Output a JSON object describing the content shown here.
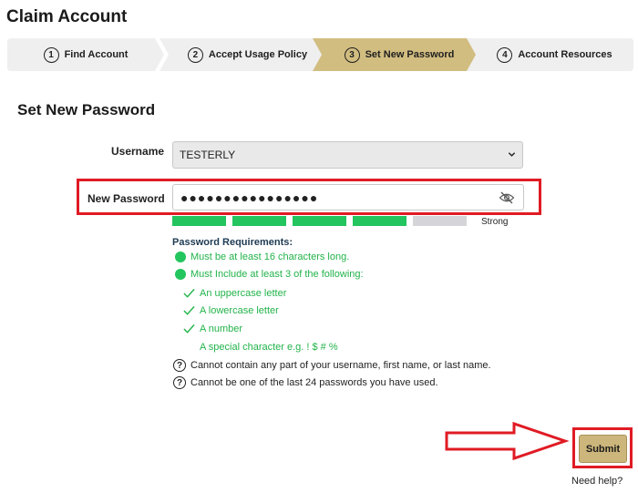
{
  "page": {
    "title": "Claim Account"
  },
  "stepper": {
    "steps": [
      {
        "num": "1",
        "label": "Find Account",
        "state": "complete"
      },
      {
        "num": "2",
        "label": "Accept Usage Policy",
        "state": "complete"
      },
      {
        "num": "3",
        "label": "Set New Password",
        "state": "active"
      },
      {
        "num": "4",
        "label": "Account Resources",
        "state": "pending"
      }
    ],
    "colors": {
      "inactive": "#efefef",
      "active": "#d2bd81"
    }
  },
  "form": {
    "section_title": "Set New Password",
    "username_label": "Username",
    "username_value": "TESTERLY",
    "password_label": "New Password",
    "password_value": "●●●●●●●●●●●●●●●●",
    "strength": {
      "filled": 4,
      "total": 5,
      "label": "Strong",
      "fill_color": "#22c55e",
      "empty_color": "#d5d5d9"
    }
  },
  "requirements": {
    "title": "Password Requirements:",
    "items": [
      {
        "kind": "dot",
        "text": "Must be at least 16 characters long."
      },
      {
        "kind": "dot",
        "text": "Must Include at least 3 of the following:"
      },
      {
        "kind": "check",
        "text": "An uppercase letter"
      },
      {
        "kind": "check",
        "text": "A lowercase letter"
      },
      {
        "kind": "check",
        "text": "A number"
      },
      {
        "kind": "none",
        "text": "A special character e.g. ! $ # %"
      },
      {
        "kind": "question",
        "text": "Cannot contain any part of your username, first name, or last name."
      },
      {
        "kind": "question",
        "text": "Cannot be one of the last 24 passwords you have used."
      }
    ]
  },
  "actions": {
    "submit_label": "Submit",
    "need_help": "Need help?"
  },
  "icons": {
    "eye_slash": "eye-slash-icon",
    "chevron": "chevron-down-icon",
    "annotation_arrow": "arrow-right-icon"
  },
  "annotation_color": "#e01b24"
}
